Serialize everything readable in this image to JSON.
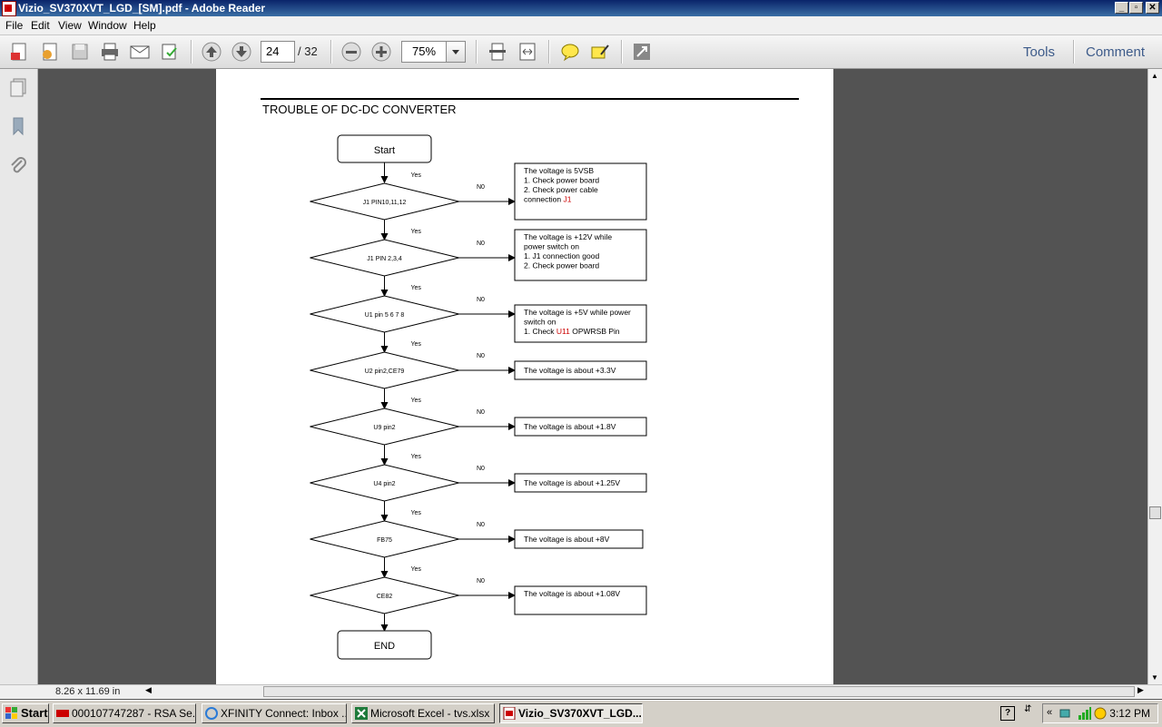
{
  "window": {
    "title": "Vizio_SV370XVT_LGD_[SM].pdf - Adobe Reader"
  },
  "menu": [
    "File",
    "Edit",
    "View",
    "Window",
    "Help"
  ],
  "toolbar": {
    "page_current": "24",
    "page_total": "/ 32",
    "zoom": "75%",
    "tools_label": "Tools",
    "comment_label": "Comment"
  },
  "document": {
    "heading": "TROUBLE OF DC-DC CONVERTER",
    "start_label": "Start",
    "end_label": "END",
    "yes_label": "Yes",
    "no_label": "N0",
    "decisions": [
      "J1 PIN10,11,12",
      "J1 PIN 2,3,4",
      "U1 pin 5 6 7 8",
      "U2 pin2,CE79",
      "U9 pin2",
      "U4 pin2",
      "FB75",
      "CE82"
    ],
    "notes": [
      {
        "lines": [
          "The voltage is 5VSB",
          "1. Check power board",
          "2. Check power cable",
          "connection "
        ],
        "highlight": "J1"
      },
      {
        "lines": [
          "The voltage is +12V while",
          "power switch on",
          "1. J1 connection good",
          "2. Check power board"
        ]
      },
      {
        "lines": [
          "The voltage is +5V while power",
          "switch on",
          "1. Check "
        ],
        "highlight": "U11",
        "suffix": " OPWRSB Pin"
      },
      {
        "lines": [
          "The voltage is about    +3.3V"
        ]
      },
      {
        "lines": [
          "The voltage is about    +1.8V"
        ]
      },
      {
        "lines": [
          "The voltage is about    +1.25V"
        ]
      },
      {
        "lines": [
          "The voltage is about    +8V"
        ]
      },
      {
        "lines": [
          "The voltage is about    +1.08V"
        ]
      }
    ],
    "page_size": "8.26 x 11.69 in"
  },
  "taskbar": {
    "start_label": "Start",
    "tasks": [
      "000107747287 - RSA Se...",
      "XFINITY Connect: Inbox ...",
      "Microsoft Excel - tvs.xlsx",
      "Vizio_SV370XVT_LGD..."
    ],
    "clock": "3:12 PM"
  },
  "colors": {
    "highlight_red": "#cc0000",
    "link_blue": "#3d5b8a"
  }
}
